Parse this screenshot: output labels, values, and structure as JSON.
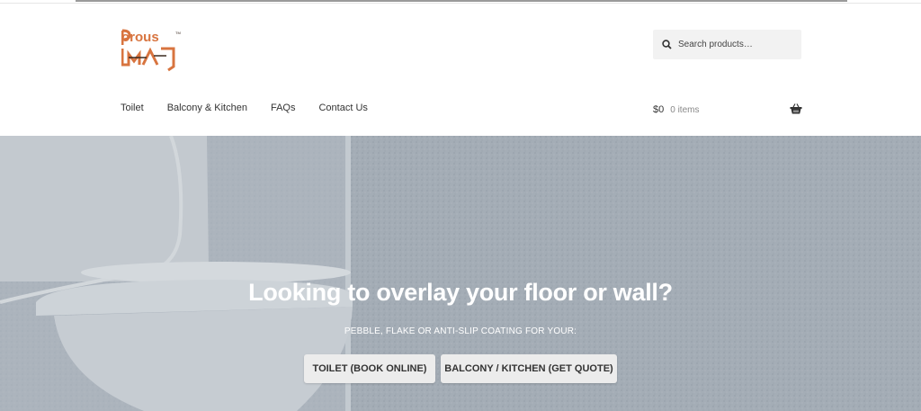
{
  "brand": {
    "logo_text": "Porous MAJ",
    "logo_colors": {
      "primary": "#d8743f",
      "dark": "#3a2a20"
    }
  },
  "search": {
    "placeholder": "Search products…"
  },
  "nav": {
    "items": [
      {
        "label": "Toilet"
      },
      {
        "label": "Balcony & Kitchen"
      },
      {
        "label": "FAQs"
      },
      {
        "label": "Contact Us"
      }
    ]
  },
  "cart": {
    "amount": "$0",
    "count": "0 items",
    "icon": "basket-icon"
  },
  "hero": {
    "title": "Looking to overlay your floor or wall?",
    "subtitle": "PEBBLE, FLAKE OR ANTI-SLIP COATING FOR YOUR:",
    "buttons": [
      {
        "label": "TOILET (BOOK ONLINE)"
      },
      {
        "label": "BALCONY / KITCHEN (GET QUOTE)"
      }
    ],
    "overlay_color": "#9ea7b1"
  }
}
